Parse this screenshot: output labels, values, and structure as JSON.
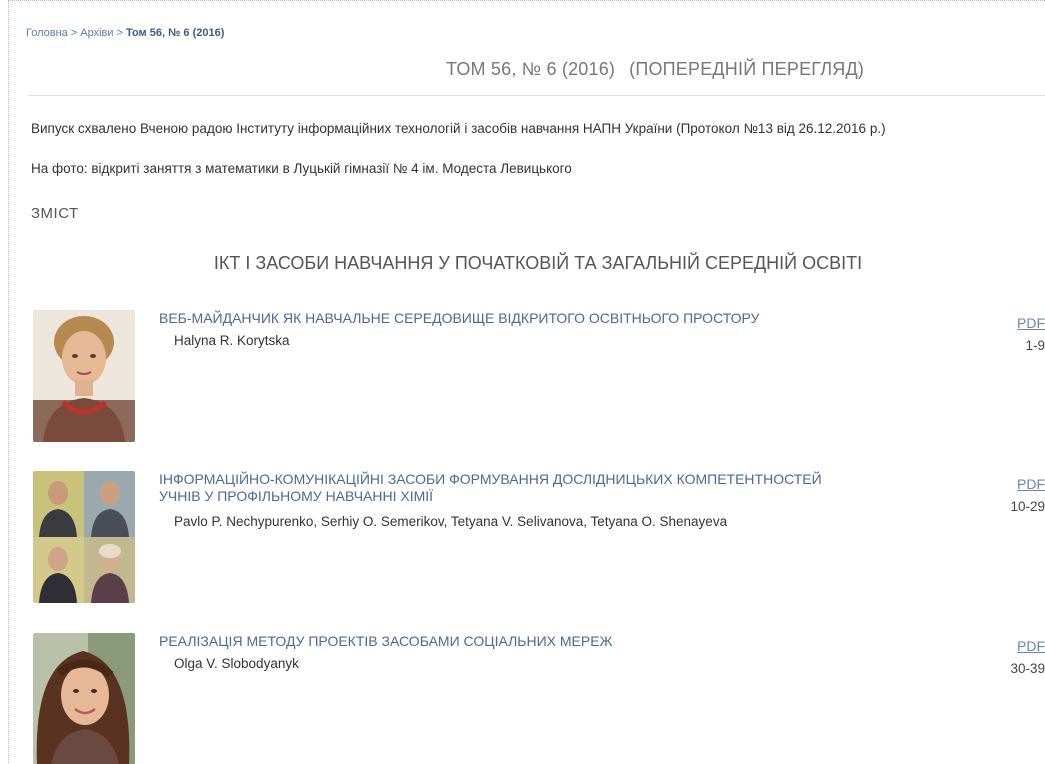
{
  "breadcrumb": {
    "home": "Головна",
    "archives": "Архіви",
    "current": "Том 56, № 6 (2016)",
    "separator": ">"
  },
  "issue": {
    "title": "ТОМ 56, № 6 (2016)",
    "subtitle": "(ПОПЕРЕДНІЙ ПЕРЕГЛЯД)",
    "approval": "Випуск схвалено Вченою радою Інституту інформаційних технологій і засобів навчання НАПН України (Протокол №13 від 26.12.2016 р.)",
    "photo_caption": "На фото: відкриті заняття з математики в Луцькій гімназії № 4 ім. Модеста Левицького"
  },
  "toc": {
    "heading": "ЗМІСТ",
    "section_title": "ІКТ І ЗАСОБИ НАВЧАННЯ У ПОЧАТКОВІЙ ТА ЗАГАЛЬНІЙ СЕРЕДНІЙ ОСВІТІ",
    "articles": [
      {
        "title": "ВЕБ-МАЙДАНЧИК ЯК НАВЧАЛЬНЕ СЕРЕДОВИЩЕ ВІДКРИТОГО ОСВІТНЬОГО ПРОСТОРУ",
        "authors": "Halyna R. Korytska",
        "galley": "PDF",
        "pages": "1-9"
      },
      {
        "title": "ІНФОРМАЦІЙНО-КОМУНІКАЦІЙНІ ЗАСОБИ ФОРМУВАННЯ ДОСЛІДНИЦЬКИХ КОМПЕТЕНТНОСТЕЙ УЧНІВ У ПРОФІЛЬНОМУ НАВЧАННІ ХІМІЇ",
        "authors": "Pavlo P. Nechypurenko, Serhiy O. Semerikov, Tetyana V. Selivanova, Tetyana O. Shenayeva",
        "galley": "PDF",
        "pages": "10-29"
      },
      {
        "title": "РЕАЛІЗАЦІЯ МЕТОДУ ПРОЕКТІВ ЗАСОБАМИ СОЦІАЛЬНИХ МЕРЕЖ",
        "authors": "Olga V. Slobodyanyk",
        "galley": "PDF",
        "pages": "30-39"
      }
    ]
  },
  "colors": {
    "link": "#4a6a96",
    "breadcrumb_current": "#3b5d8a",
    "muted_title": "#777777"
  }
}
